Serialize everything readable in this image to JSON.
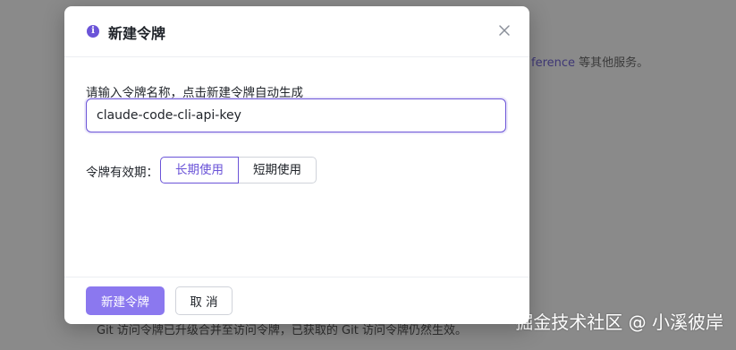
{
  "background": {
    "link_text": "ference",
    "after_link": " 等其他服务。",
    "bottom_text": "Git 访问令牌已升级合并至访问令牌，已获取的 Git 访问令牌仍然生效。",
    "watermark": "掘金技术社区 @ 小溪彼岸"
  },
  "modal": {
    "title": "新建令牌",
    "info_icon": "info-icon",
    "close_icon": "close-icon",
    "prompt_label": "请输入令牌名称，点击新建令牌自动生成",
    "token_name_value": "claude-code-cli-api-key",
    "validity_label": "令牌有效期：",
    "validity_options": [
      "长期使用",
      "短期使用"
    ],
    "validity_selected": "长期使用",
    "create_button": "新建令牌",
    "cancel_button": "取 消"
  },
  "colors": {
    "accent": "#6b54d8",
    "primary_button": "#8b78ef"
  }
}
